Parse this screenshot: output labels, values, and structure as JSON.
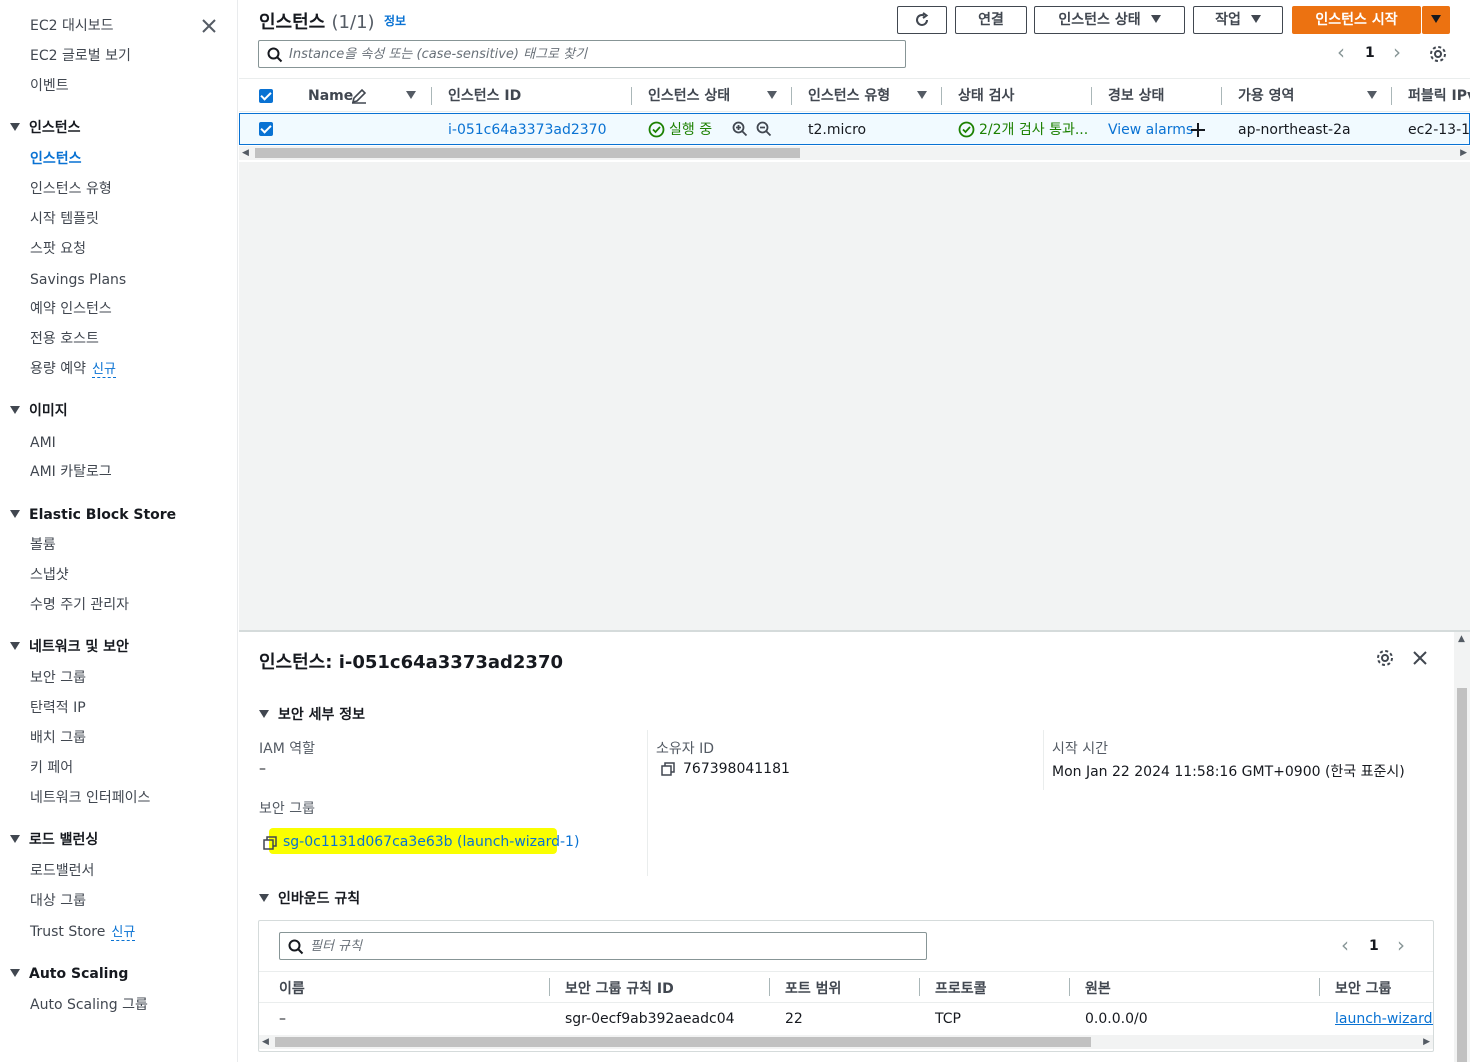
{
  "sidebar": {
    "top_items": [
      "EC2 대시보드",
      "EC2 글로벌 보기",
      "이벤트"
    ],
    "sections": [
      {
        "title": "인스턴스",
        "items": [
          "인스턴스",
          "인스턴스 유형",
          "시작 템플릿",
          "스팟 요청",
          "Savings Plans",
          "예약 인스턴스",
          "전용 호스트",
          "용량 예약"
        ]
      },
      {
        "title": "이미지",
        "items": [
          "AMI",
          "AMI 카탈로그"
        ]
      },
      {
        "title": "Elastic Block Store",
        "items": [
          "볼륨",
          "스냅샷",
          "수명 주기 관리자"
        ]
      },
      {
        "title": "네트워크 및 보안",
        "items": [
          "보안 그룹",
          "탄력적 IP",
          "배치 그룹",
          "키 페어",
          "네트워크 인터페이스"
        ]
      },
      {
        "title": "로드 밸런싱",
        "items": [
          "로드밸런서",
          "대상 그룹",
          "Trust Store"
        ]
      },
      {
        "title": "Auto Scaling",
        "items": [
          "Auto Scaling 그룹"
        ]
      }
    ],
    "new_badge": "신규"
  },
  "list": {
    "title": "인스턴스",
    "count": "(1/1)",
    "info": "정보",
    "buttons": {
      "connect": "연결",
      "instance_state": "인스턴스 상태",
      "actions": "작업",
      "launch": "인스턴스 시작"
    },
    "search_placeholder": "Instance을 속성 또는 (case-sensitive) 태그로 찾기",
    "page": "1",
    "columns": [
      "Name",
      "인스턴스 ID",
      "인스턴스 상태",
      "인스턴스 유형",
      "상태 검사",
      "경보 상태",
      "가용 영역",
      "퍼블릭 IPv"
    ],
    "row": {
      "name": "",
      "instance_id": "i-051c64a3373ad2370",
      "state": "실행 중",
      "type": "t2.micro",
      "status_check": "2/2개 검사 통과...",
      "alarm": "View alarms",
      "az": "ap-northeast-2a",
      "public_ip": "ec2-13-12"
    }
  },
  "detail": {
    "title": "인스턴스: i-051c64a3373ad2370",
    "security_section": "보안 세부 정보",
    "iam_label": "IAM 역할",
    "iam_value": "–",
    "owner_label": "소유자 ID",
    "owner_value": "767398041181",
    "launch_label": "시작 시간",
    "launch_value": "Mon Jan 22 2024 11:58:16 GMT+0900 (한국 표준시)",
    "sg_label": "보안 그룹",
    "sg_value": "sg-0c1131d067ca3e63b (launch-wizard-1)",
    "inbound_section": "인바운드 규칙",
    "filter_placeholder": "필터 규칙",
    "page": "1",
    "rule_columns": [
      "이름",
      "보안 그룹 규칙 ID",
      "포트 범위",
      "프로토콜",
      "원본",
      "보안 그룹"
    ],
    "rule_row": [
      "–",
      "sgr-0ecf9ab392aeadc04",
      "22",
      "TCP",
      "0.0.0.0/0",
      "launch-wizard-1"
    ]
  },
  "colors": {
    "accent": "#0972d3",
    "primary_button": "#ec7211",
    "ok": "#1d8102",
    "highlight": "#faff00"
  }
}
